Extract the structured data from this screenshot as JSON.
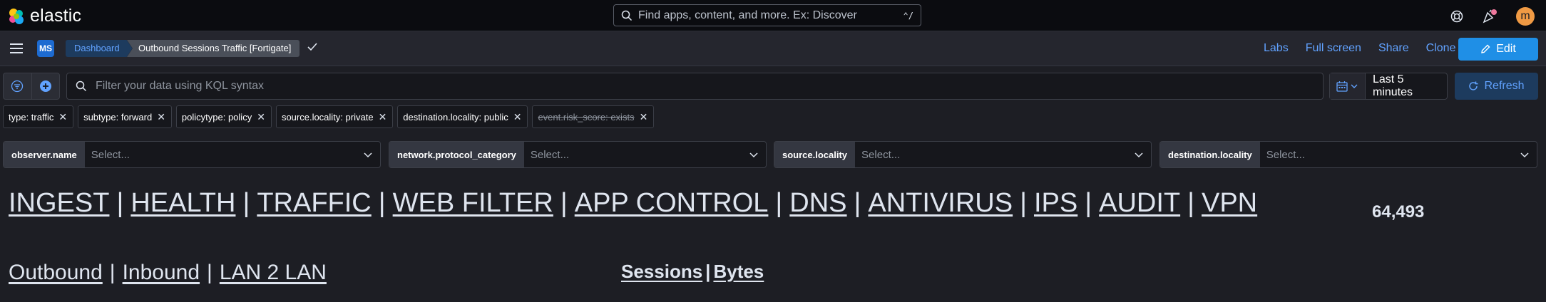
{
  "header": {
    "brand": "elastic",
    "search_placeholder": "Find apps, content, and more. Ex: Discover",
    "search_shortcut": "⌃/",
    "avatar_initial": "m",
    "colors": {
      "accent": "#1f8fe6",
      "avatar": "#f09a44",
      "notification": "#ee789d"
    }
  },
  "nav": {
    "space_initials": "MS",
    "breadcrumbs": [
      "Dashboard",
      "Outbound Sessions Traffic [Fortigate]"
    ],
    "links": [
      "Labs",
      "Full screen",
      "Share",
      "Clone"
    ],
    "edit_label": "Edit"
  },
  "query": {
    "placeholder": "Filter your data using KQL syntax",
    "time_range": "Last 5 minutes",
    "refresh_label": "Refresh"
  },
  "filters": [
    {
      "label": "type: traffic",
      "disabled": false
    },
    {
      "label": "subtype: forward",
      "disabled": false
    },
    {
      "label": "policytype: policy",
      "disabled": false
    },
    {
      "label": "source.locality: private",
      "disabled": false
    },
    {
      "label": "destination.locality: public",
      "disabled": false
    },
    {
      "label": "event.risk_score: exists",
      "disabled": true
    }
  ],
  "controls": [
    {
      "label": "observer.name",
      "placeholder": "Select..."
    },
    {
      "label": "network.protocol_category",
      "placeholder": "Select..."
    },
    {
      "label": "source.locality",
      "placeholder": "Select..."
    },
    {
      "label": "destination.locality",
      "placeholder": "Select..."
    }
  ],
  "panel": {
    "nav_links": [
      "INGEST",
      "HEALTH",
      "TRAFFIC",
      "WEB FILTER",
      "APP CONTROL",
      "DNS",
      "ANTIVIRUS",
      "IPS",
      "AUDIT",
      "VPN"
    ],
    "metric_value": "64,493",
    "direction_links": [
      "Outbound",
      "Inbound",
      "LAN 2 LAN"
    ],
    "metric_links": [
      "Sessions",
      "Bytes"
    ],
    "separator": "|"
  }
}
